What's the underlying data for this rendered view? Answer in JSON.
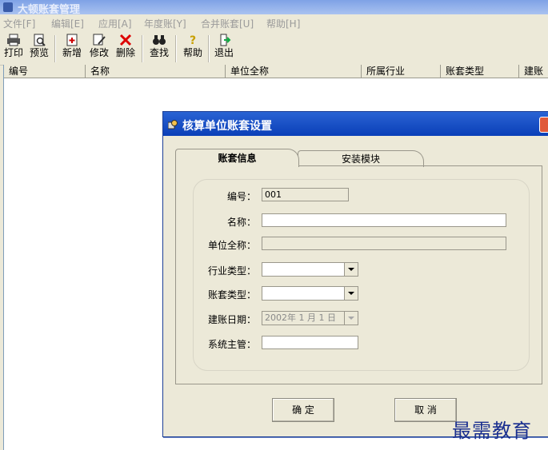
{
  "window": {
    "title": "大顿账套管理"
  },
  "menu": [
    {
      "label": "文件[F]"
    },
    {
      "label": "编辑[E]"
    },
    {
      "label": "应用[A]"
    },
    {
      "label": "年度账[Y]"
    },
    {
      "label": "合并账套[U]"
    },
    {
      "label": "帮助[H]"
    }
  ],
  "toolbar": [
    {
      "label": "打印",
      "icon": "printer-icon"
    },
    {
      "label": "预览",
      "icon": "preview-icon"
    },
    {
      "label": "新增",
      "icon": "add-icon"
    },
    {
      "label": "修改",
      "icon": "edit-icon"
    },
    {
      "label": "删除",
      "icon": "delete-icon"
    },
    {
      "label": "查找",
      "icon": "binoculars-icon"
    },
    {
      "label": "帮助",
      "icon": "help-icon"
    },
    {
      "label": "退出",
      "icon": "exit-icon"
    }
  ],
  "grid": {
    "columns": [
      "编号",
      "名称",
      "单位全称",
      "所属行业",
      "账套类型",
      "建账"
    ]
  },
  "dialog": {
    "title": "核算单位账套设置",
    "tabs": [
      {
        "label": "账套信息",
        "active": true
      },
      {
        "label": "安装模块",
        "active": false
      }
    ],
    "fields": {
      "code": {
        "label": "编号：",
        "value": "001"
      },
      "name": {
        "label": "名称：",
        "value": ""
      },
      "fullname": {
        "label": "单位全称：",
        "value": ""
      },
      "industry": {
        "label": "行业类型：",
        "value": ""
      },
      "booktype": {
        "label": "账套类型：",
        "value": ""
      },
      "date": {
        "label": "建账日期：",
        "value": "2002年 1 月 1 日"
      },
      "manager": {
        "label": "系统主管：",
        "value": ""
      }
    },
    "ok_label": "确 定",
    "cancel_label": "取 消"
  },
  "watermark": "最需教育",
  "colors": {
    "title_active": "#0a3fb8",
    "title_inactive": "#a9c2f0",
    "window_bg": "#ece9d8",
    "watermark": "#1a2f8f"
  }
}
